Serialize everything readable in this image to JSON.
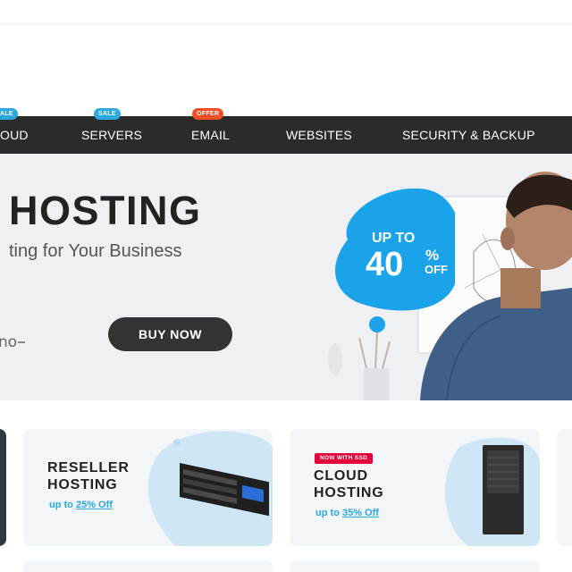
{
  "nav": {
    "items": [
      {
        "label": "OUD",
        "badge": "SALE"
      },
      {
        "label": "SERVERS",
        "badge": "SALE"
      },
      {
        "label": "EMAIL",
        "badge": "OFFER"
      },
      {
        "label": "WEBSITES"
      },
      {
        "label": "SECURITY & BACKUP"
      }
    ],
    "badge_colors": {
      "sale": "#2aa8df",
      "offer": "#f04e23"
    }
  },
  "hero": {
    "title": "HOSTING",
    "subtitle": "ting for Your Business",
    "brand_partial": "no",
    "cta_label": "BUY NOW",
    "promo": {
      "up_to": "UP TO",
      "value": "40",
      "percent": "%",
      "off": "OFF"
    }
  },
  "cards": [
    {
      "title_line1": "RESELLER",
      "title_line2": "HOSTING",
      "offer_prefix": "up to",
      "offer_value": "25% Off"
    },
    {
      "badge": "NOW WITH SSD",
      "title_line1": "CLOUD",
      "title_line2": "HOSTING",
      "offer_prefix": "up to",
      "offer_value": "35% Off"
    }
  ],
  "colors": {
    "nav_bg": "#2b2b2b",
    "accent": "#2aa8df",
    "cta_bg": "#333333",
    "card_bg": "#f3f6f9",
    "ssd_badge": "#e4003b"
  }
}
